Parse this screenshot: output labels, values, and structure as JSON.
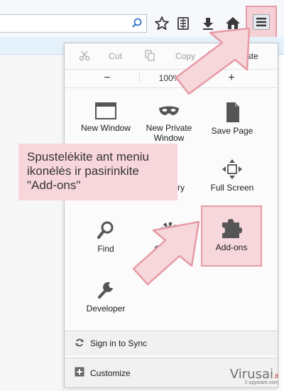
{
  "toolbar": {
    "icons": [
      "search-icon",
      "star-icon",
      "reading-list-icon",
      "download-icon",
      "home-icon",
      "hamburger-menu-icon"
    ]
  },
  "menu": {
    "edit": {
      "cut": "Cut",
      "copy": "Copy",
      "paste": "Paste"
    },
    "zoom": {
      "minus": "−",
      "level": "100%",
      "plus": "+"
    },
    "items": {
      "new_window": "New Window",
      "new_private_window": "New Private Window",
      "save_page": "Save Page",
      "history_partial": "ry",
      "full_screen": "Full Screen",
      "find": "Find",
      "options": "Options",
      "addons": "Add-ons",
      "developer": "Developer"
    },
    "sign_in": "Sign in to Sync",
    "customize": "Customize"
  },
  "callout": {
    "text": "Spustelėkite ant meniu ikonėlės ir pasirinkite \"Add-ons\""
  },
  "watermark": {
    "main": "Virusai",
    "suffix": ".lt",
    "sub": "2-spyware.com"
  },
  "colors": {
    "highlight": "#f6d7db",
    "highlight_border": "#e79aa6"
  }
}
